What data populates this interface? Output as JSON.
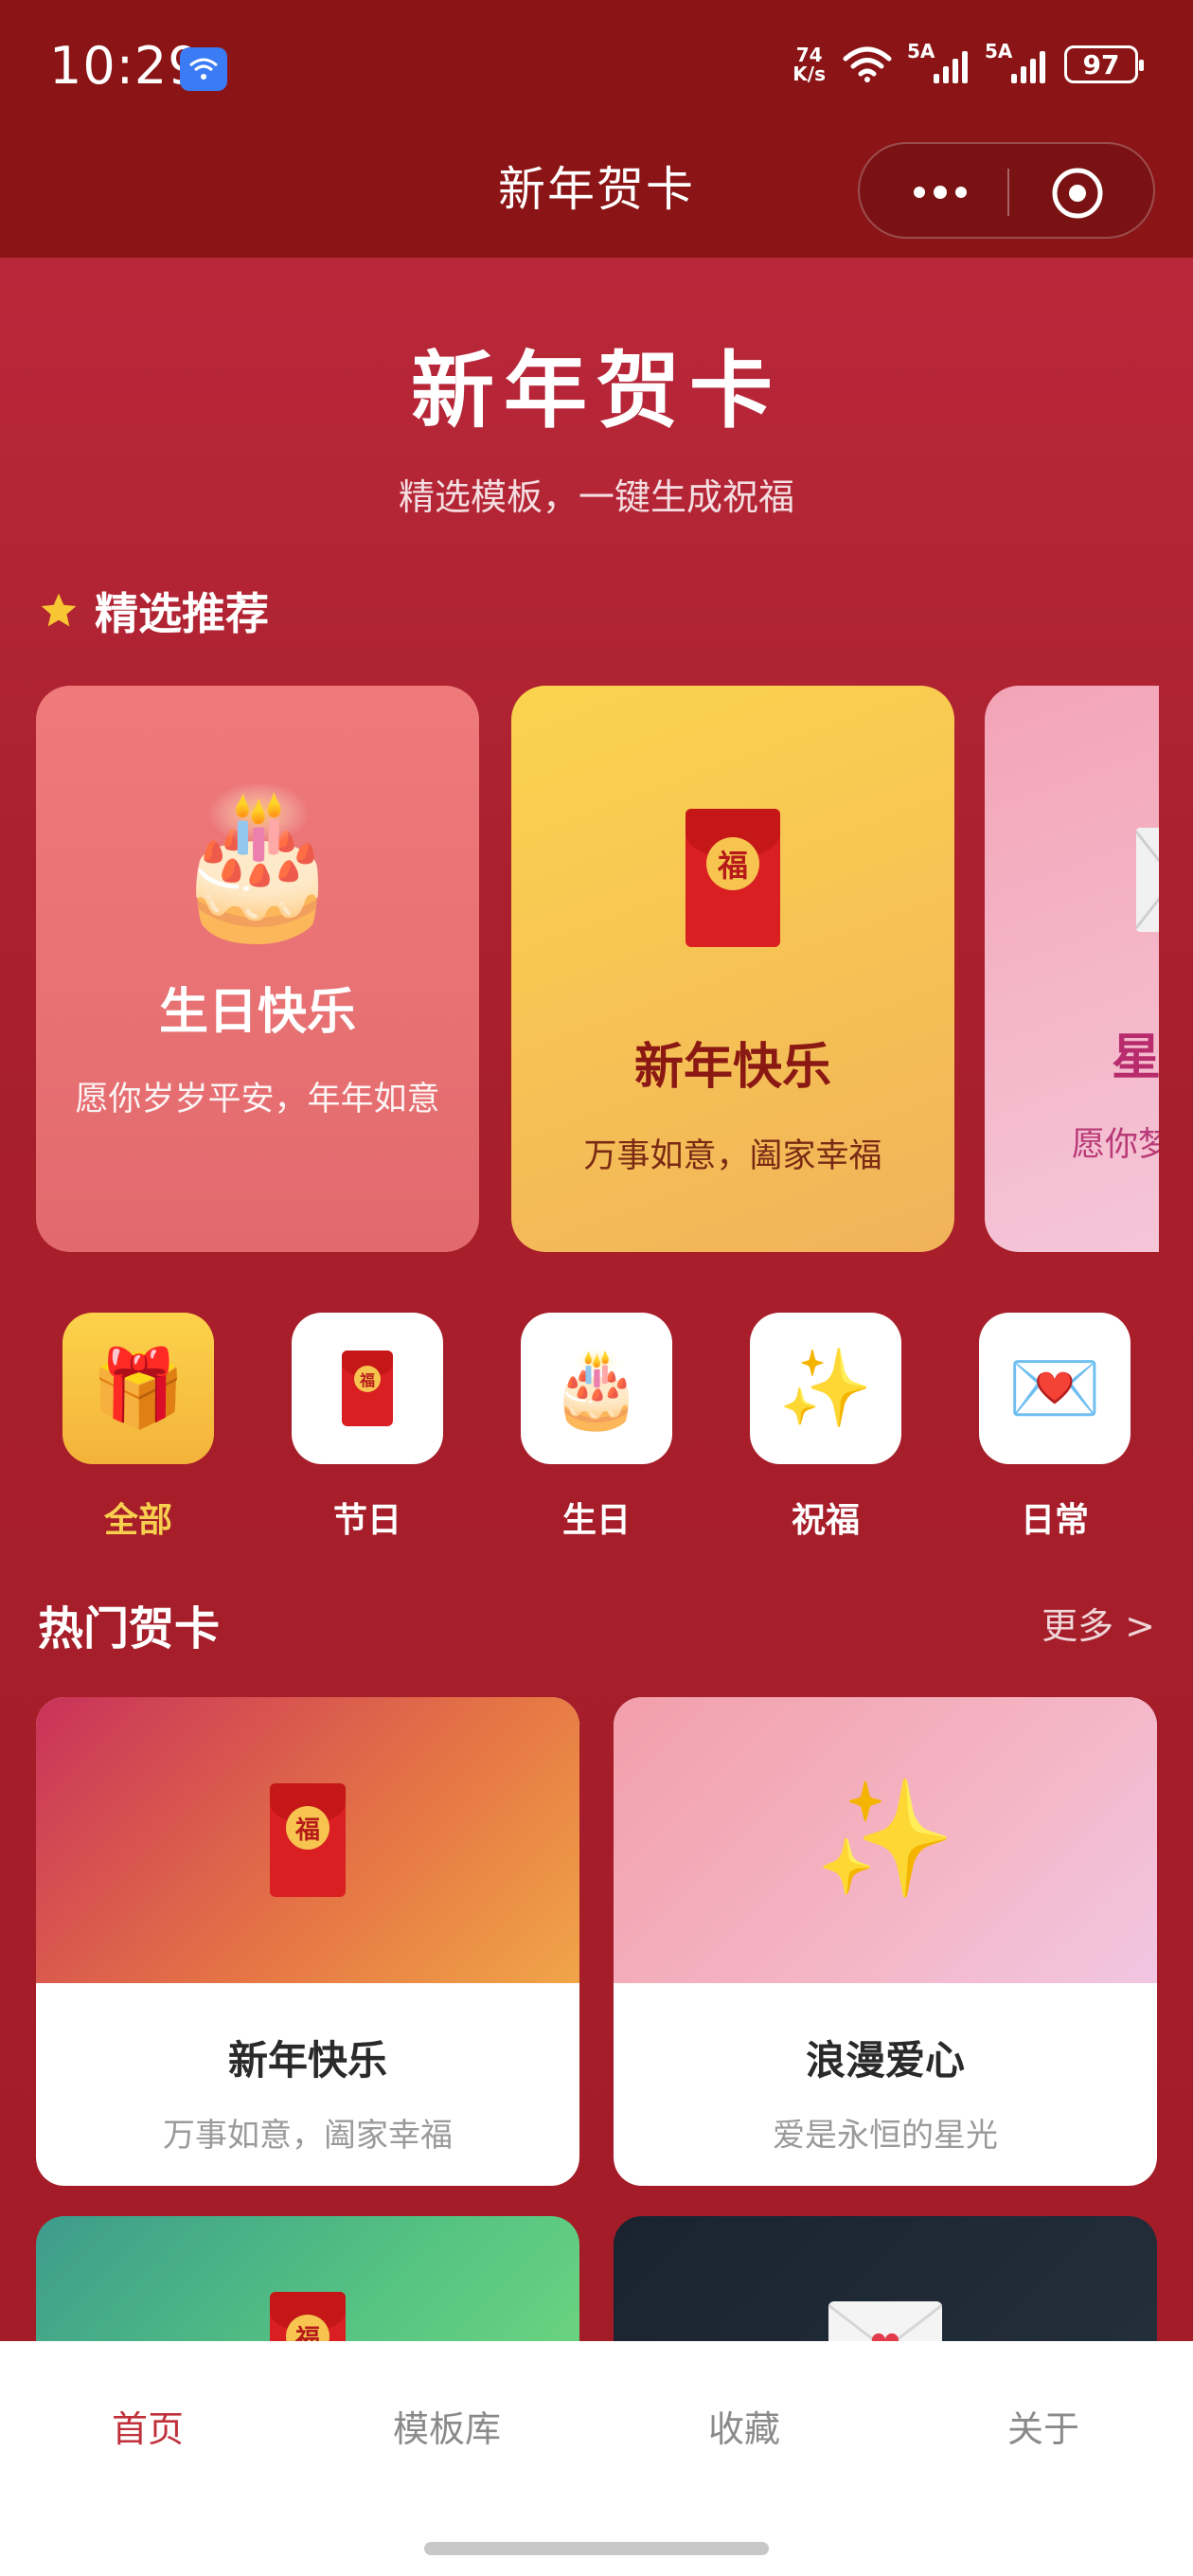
{
  "status_bar": {
    "time": "10:29",
    "net_speed_value": "74",
    "net_speed_unit": "K/s",
    "sim1_label": "5A",
    "sim2_label": "5A",
    "battery": "97"
  },
  "nav": {
    "title": "新年贺卡"
  },
  "hero": {
    "title": "新年贺卡",
    "subtitle": "精选模板，一键生成祝福"
  },
  "featured": {
    "section_title": "精选推荐",
    "cards": [
      {
        "icon": "cake-icon",
        "title": "生日快乐",
        "desc": "愿你岁岁平安，年年如意"
      },
      {
        "icon": "red-envelope-icon",
        "title": "新年快乐",
        "desc": "万事如意，阖家幸福"
      },
      {
        "icon": "envelope-icon",
        "title": "星",
        "desc": "愿你梦"
      }
    ]
  },
  "categories": [
    {
      "icon": "gift-icon",
      "label": "全部",
      "active": true
    },
    {
      "icon": "red-envelope-icon",
      "label": "节日",
      "active": false
    },
    {
      "icon": "cake-icon",
      "label": "生日",
      "active": false
    },
    {
      "icon": "sparkles-icon",
      "label": "祝福",
      "active": false
    },
    {
      "icon": "love-letter-icon",
      "label": "日常",
      "active": false
    }
  ],
  "hot": {
    "section_title": "热门贺卡",
    "more_label": "更多 >",
    "cards": [
      {
        "icon": "red-envelope-icon",
        "title": "新年快乐",
        "desc": "万事如意，阖家幸福"
      },
      {
        "icon": "sparkles-icon",
        "title": "浪漫爱心",
        "desc": "爱是永恒的星光"
      },
      {
        "icon": "red-envelope-icon"
      },
      {
        "icon": "love-letter-icon"
      }
    ]
  },
  "envelope_seal_char": "福",
  "tabbar": {
    "tabs": [
      {
        "label": "首页",
        "active": true
      },
      {
        "label": "模板库",
        "active": false
      },
      {
        "label": "收藏",
        "active": false
      },
      {
        "label": "关于",
        "active": false
      }
    ]
  },
  "colors": {
    "background": "#a81f2b",
    "topbar": "#8b1516",
    "accent_gold": "#f8cf4e",
    "tab_active": "#c0303a"
  }
}
